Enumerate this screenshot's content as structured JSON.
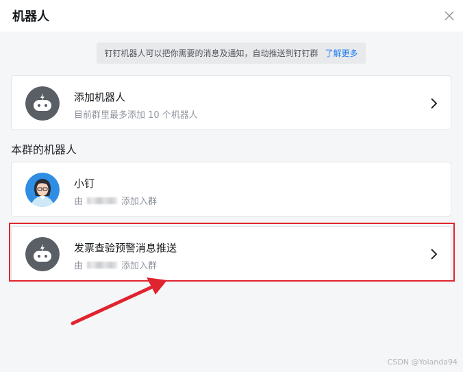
{
  "dialog": {
    "title": "机器人",
    "close_icon": "close-icon"
  },
  "notice": {
    "text": "钉钉机器人可以把你需要的消息及通知，自动推送到钉钉群",
    "link": "了解更多"
  },
  "add_robot": {
    "title": "添加机器人",
    "subtitle": "目前群里最多添加 10 个机器人"
  },
  "section_title": "本群的机器人",
  "robots": [
    {
      "name": "小钉",
      "prefix": "由",
      "suffix": "添加入群",
      "avatar": "person-avatar"
    },
    {
      "name": "发票查验预警消息推送",
      "prefix": "由",
      "suffix": "添加入群",
      "avatar": "robot-avatar"
    }
  ],
  "watermark": "CSDN @Yolanda94",
  "colors": {
    "accent_link": "#1a7df5",
    "highlight_red": "#e0242f",
    "robot_avatar_bg": "#5a5f66"
  }
}
